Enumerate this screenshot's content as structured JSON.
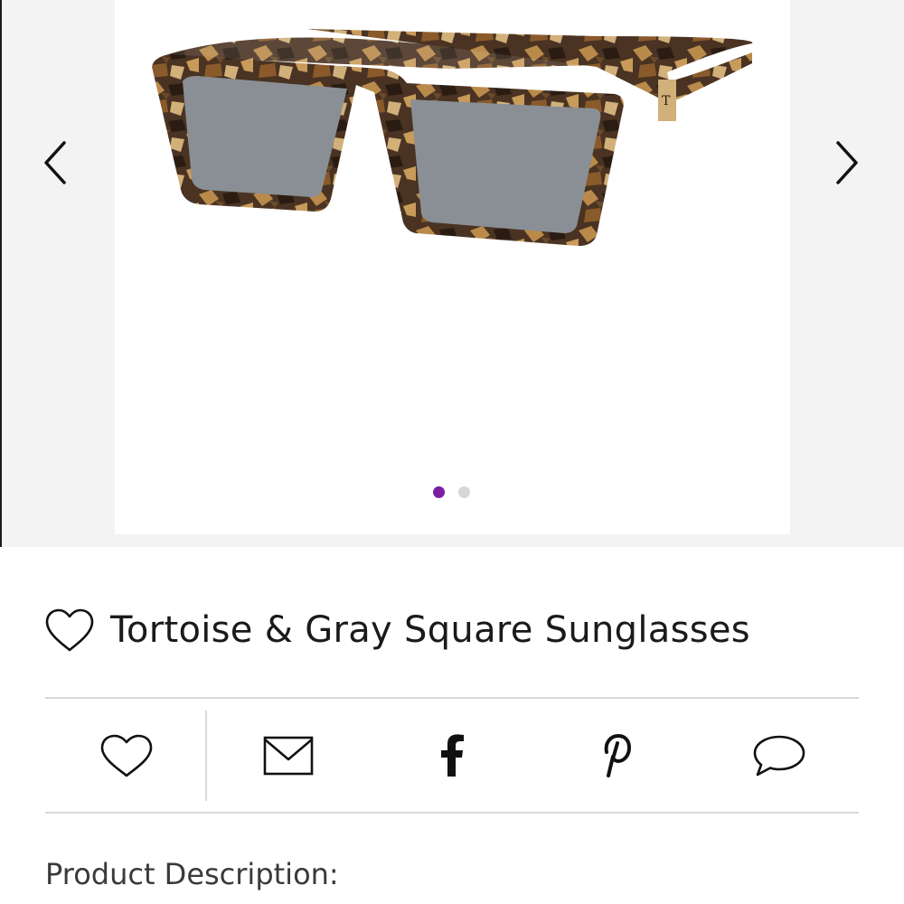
{
  "gallery": {
    "image_alt": "Tortoise & Gray Square Sunglasses product image",
    "prev_icon": "chevron-left-icon",
    "next_icon": "chevron-right-icon",
    "dots": [
      {
        "active": true
      },
      {
        "active": false
      }
    ],
    "colors": {
      "active_dot": "#7b1fa2",
      "inactive_dot": "#d7d7d7",
      "frame_background": "#ffffff",
      "gallery_background": "#f3f3f3"
    }
  },
  "product": {
    "title": "Tortoise & Gray Square Sunglasses",
    "favorite_icon": "heart-outline-icon"
  },
  "actions": [
    {
      "name": "favorite",
      "icon": "heart-outline-icon"
    },
    {
      "name": "email",
      "icon": "envelope-icon"
    },
    {
      "name": "facebook",
      "icon": "facebook-icon"
    },
    {
      "name": "pinterest",
      "icon": "pinterest-icon"
    },
    {
      "name": "comment",
      "icon": "speech-bubble-icon"
    }
  ],
  "description": {
    "heading": "Product Description:"
  }
}
